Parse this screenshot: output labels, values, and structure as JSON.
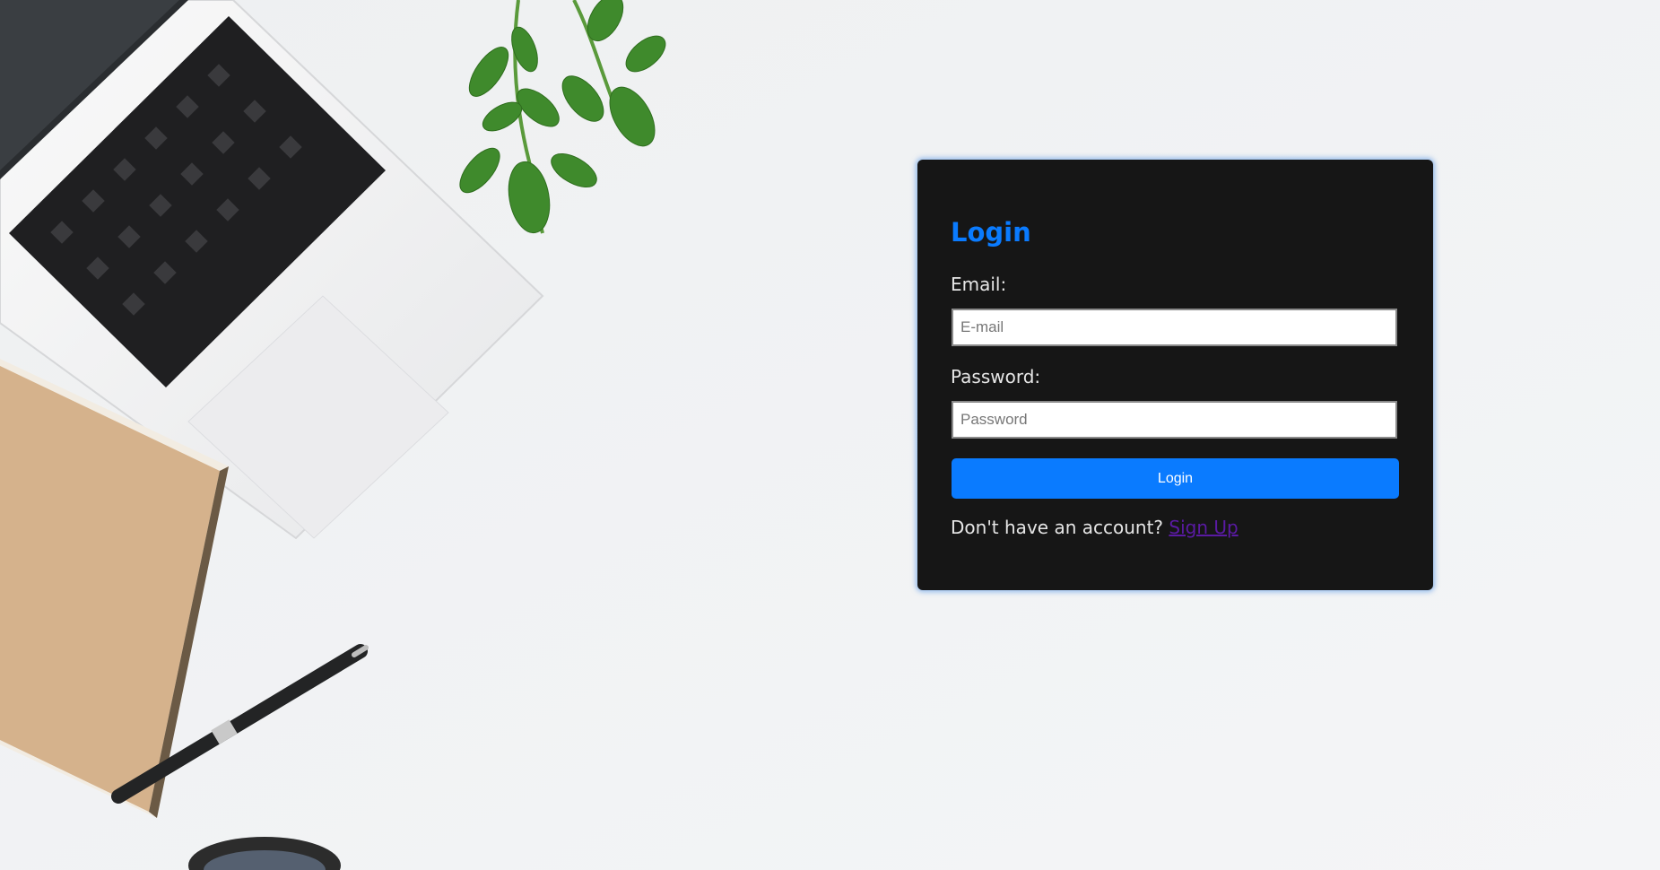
{
  "login_card": {
    "title": "Login",
    "email_label": "Email:",
    "email_placeholder": "E-mail",
    "email_value": "",
    "password_label": "Password:",
    "password_placeholder": "Password",
    "password_value": "",
    "submit_label": "Login",
    "signup_prompt": "Don't have an account?",
    "signup_link": "Sign Up"
  },
  "colors": {
    "card_background": "#161616",
    "accent": "#0a7bff",
    "link_visited": "#5a1aa3",
    "page_background": "#f2f3f4"
  },
  "background_scene": {
    "icons": [
      "laptop-icon",
      "keyboard-icon",
      "plant-icon",
      "notebook-icon",
      "pen-icon",
      "mug-icon"
    ]
  }
}
